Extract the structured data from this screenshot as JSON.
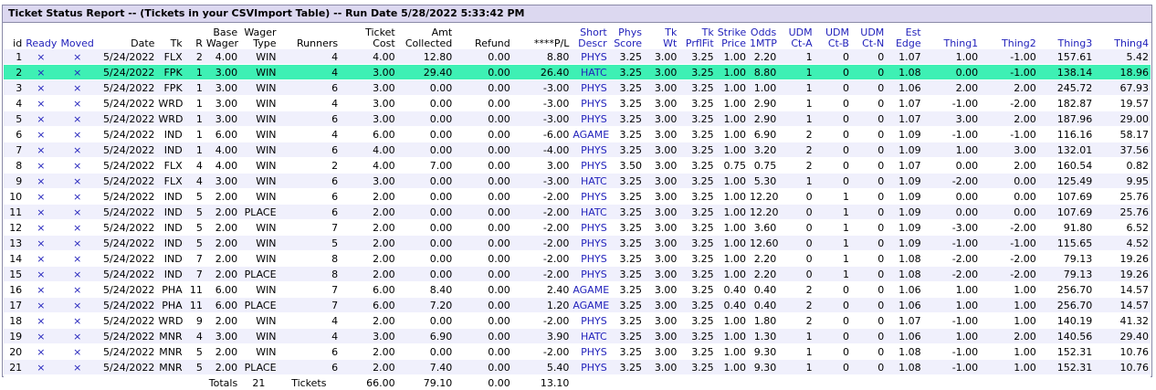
{
  "report": {
    "title": "Ticket Status Report -- (Tickets in your CSVImport Table)  -- Run Date 5/28/2022 5:33:42 PM"
  },
  "columns": [
    {
      "key": "id",
      "l1": "",
      "l2": "id",
      "blue": false,
      "w": 22,
      "align": "right"
    },
    {
      "key": "ready",
      "l1": "",
      "l2": "Ready",
      "blue": true,
      "w": 37,
      "align": "center"
    },
    {
      "key": "moved",
      "l1": "",
      "l2": "Moved",
      "blue": true,
      "w": 42,
      "align": "center"
    },
    {
      "key": "date",
      "l1": "",
      "l2": "Date",
      "blue": false,
      "w": 65,
      "align": "right"
    },
    {
      "key": "tk",
      "l1": "",
      "l2": "Tk",
      "blue": false,
      "w": 30,
      "align": "right"
    },
    {
      "key": "r",
      "l1": "",
      "l2": "R",
      "blue": false,
      "w": 22,
      "align": "right"
    },
    {
      "key": "base_wager",
      "l1": "Base",
      "l2": "Wager",
      "blue": false,
      "w": 38,
      "align": "right"
    },
    {
      "key": "wager_type",
      "l1": "Wager",
      "l2": "Type",
      "blue": false,
      "w": 42,
      "align": "right"
    },
    {
      "key": "runners",
      "l1": "",
      "l2": "Runners",
      "blue": false,
      "w": 67,
      "align": "right"
    },
    {
      "key": "ticket_cost",
      "l1": "Ticket",
      "l2": "Cost",
      "blue": false,
      "w": 62,
      "align": "right"
    },
    {
      "key": "amt_collected",
      "l1": "Amt",
      "l2": "Collected",
      "blue": false,
      "w": 62,
      "align": "right"
    },
    {
      "key": "refund",
      "l1": "",
      "l2": "Refund",
      "blue": false,
      "w": 63,
      "align": "right"
    },
    {
      "key": "pl",
      "l1": "",
      "l2": "****P/L",
      "blue": false,
      "w": 64,
      "align": "right"
    },
    {
      "key": "short_descr",
      "l1": "Short",
      "l2": "Descr",
      "blue": true,
      "w": 41,
      "align": "right"
    },
    {
      "key": "phys_score",
      "l1": "Phys",
      "l2": "Score",
      "blue": true,
      "w": 38,
      "align": "right"
    },
    {
      "key": "tk_wt",
      "l1": "Tk",
      "l2": "Wt",
      "blue": true,
      "w": 38,
      "align": "right"
    },
    {
      "key": "tk_prflfit",
      "l1": "Tk",
      "l2": "PrflFit",
      "blue": true,
      "w": 40,
      "align": "right"
    },
    {
      "key": "strike_price",
      "l1": "Strike",
      "l2": "Price",
      "blue": true,
      "w": 35,
      "align": "right"
    },
    {
      "key": "odds_1mtp",
      "l1": "Odds",
      "l2": "1MTP",
      "blue": true,
      "w": 33,
      "align": "right"
    },
    {
      "key": "udm_ct_a",
      "l1": "UDM",
      "l2": "Ct-A",
      "blue": true,
      "w": 39,
      "align": "right"
    },
    {
      "key": "udm_ct_b",
      "l1": "UDM",
      "l2": "Ct-B",
      "blue": true,
      "w": 40,
      "align": "right"
    },
    {
      "key": "udm_ct_n",
      "l1": "UDM",
      "l2": "Ct-N",
      "blue": true,
      "w": 38,
      "align": "right"
    },
    {
      "key": "est_edge",
      "l1": "Est",
      "l2": "Edge",
      "blue": true,
      "w": 40,
      "align": "right"
    },
    {
      "key": "thing1",
      "l1": "",
      "l2": "Thing1",
      "blue": true,
      "w": 62,
      "align": "right"
    },
    {
      "key": "thing2",
      "l1": "",
      "l2": "Thing2",
      "blue": true,
      "w": 63,
      "align": "right"
    },
    {
      "key": "thing3",
      "l1": "",
      "l2": "Thing3",
      "blue": true,
      "w": 61,
      "align": "right"
    },
    {
      "key": "thing4",
      "l1": "",
      "l2": "Thing4",
      "blue": true,
      "w": 61,
      "align": "right"
    }
  ],
  "selected_row": 1,
  "rows": [
    [
      "1",
      "×",
      "×",
      "5/24/2022",
      "FLX",
      "2",
      "4.00",
      "WIN",
      "4",
      "4.00",
      "12.80",
      "0.00",
      "8.80",
      "PHYS",
      "3.25",
      "3.00",
      "3.25",
      "1.00",
      "2.20",
      "1",
      "0",
      "0",
      "1.07",
      "1.00",
      "-1.00",
      "157.61",
      "5.42"
    ],
    [
      "2",
      "×",
      "×",
      "5/24/2022",
      "FPK",
      "1",
      "3.00",
      "WIN",
      "4",
      "3.00",
      "29.40",
      "0.00",
      "26.40",
      "HATC",
      "3.25",
      "3.00",
      "3.25",
      "1.00",
      "8.80",
      "1",
      "0",
      "0",
      "1.08",
      "0.00",
      "-1.00",
      "138.14",
      "18.96"
    ],
    [
      "3",
      "×",
      "×",
      "5/24/2022",
      "FPK",
      "1",
      "3.00",
      "WIN",
      "6",
      "3.00",
      "0.00",
      "0.00",
      "-3.00",
      "PHYS",
      "3.25",
      "3.00",
      "3.25",
      "1.00",
      "1.00",
      "1",
      "0",
      "0",
      "1.06",
      "2.00",
      "2.00",
      "245.72",
      "67.93"
    ],
    [
      "4",
      "×",
      "×",
      "5/24/2022",
      "WRD",
      "1",
      "3.00",
      "WIN",
      "4",
      "3.00",
      "0.00",
      "0.00",
      "-3.00",
      "PHYS",
      "3.25",
      "3.00",
      "3.25",
      "1.00",
      "2.90",
      "1",
      "0",
      "0",
      "1.07",
      "-1.00",
      "-2.00",
      "182.87",
      "19.57"
    ],
    [
      "5",
      "×",
      "×",
      "5/24/2022",
      "WRD",
      "1",
      "3.00",
      "WIN",
      "6",
      "3.00",
      "0.00",
      "0.00",
      "-3.00",
      "PHYS",
      "3.25",
      "3.00",
      "3.25",
      "1.00",
      "2.90",
      "1",
      "0",
      "0",
      "1.07",
      "3.00",
      "2.00",
      "187.96",
      "29.00"
    ],
    [
      "6",
      "×",
      "×",
      "5/24/2022",
      "IND",
      "1",
      "6.00",
      "WIN",
      "4",
      "6.00",
      "0.00",
      "0.00",
      "-6.00",
      "AGAME",
      "3.25",
      "3.00",
      "3.25",
      "1.00",
      "6.90",
      "2",
      "0",
      "0",
      "1.09",
      "-1.00",
      "-1.00",
      "116.16",
      "58.17"
    ],
    [
      "7",
      "×",
      "×",
      "5/24/2022",
      "IND",
      "1",
      "4.00",
      "WIN",
      "6",
      "4.00",
      "0.00",
      "0.00",
      "-4.00",
      "PHYS",
      "3.25",
      "3.00",
      "3.25",
      "1.00",
      "3.20",
      "2",
      "0",
      "0",
      "1.09",
      "1.00",
      "3.00",
      "132.01",
      "37.56"
    ],
    [
      "8",
      "×",
      "×",
      "5/24/2022",
      "FLX",
      "4",
      "4.00",
      "WIN",
      "2",
      "4.00",
      "7.00",
      "0.00",
      "3.00",
      "PHYS",
      "3.50",
      "3.00",
      "3.25",
      "0.75",
      "0.75",
      "2",
      "0",
      "0",
      "1.07",
      "0.00",
      "2.00",
      "160.54",
      "0.82"
    ],
    [
      "9",
      "×",
      "×",
      "5/24/2022",
      "FLX",
      "4",
      "3.00",
      "WIN",
      "6",
      "3.00",
      "0.00",
      "0.00",
      "-3.00",
      "HATC",
      "3.25",
      "3.00",
      "3.25",
      "1.00",
      "5.30",
      "1",
      "0",
      "0",
      "1.09",
      "-2.00",
      "0.00",
      "125.49",
      "9.95"
    ],
    [
      "10",
      "×",
      "×",
      "5/24/2022",
      "IND",
      "5",
      "2.00",
      "WIN",
      "6",
      "2.00",
      "0.00",
      "0.00",
      "-2.00",
      "PHYS",
      "3.25",
      "3.00",
      "3.25",
      "1.00",
      "12.20",
      "0",
      "1",
      "0",
      "1.09",
      "0.00",
      "0.00",
      "107.69",
      "25.76"
    ],
    [
      "11",
      "×",
      "×",
      "5/24/2022",
      "IND",
      "5",
      "2.00",
      "PLACE",
      "6",
      "2.00",
      "0.00",
      "0.00",
      "-2.00",
      "HATC",
      "3.25",
      "3.00",
      "3.25",
      "1.00",
      "12.20",
      "0",
      "1",
      "0",
      "1.09",
      "0.00",
      "0.00",
      "107.69",
      "25.76"
    ],
    [
      "12",
      "×",
      "×",
      "5/24/2022",
      "IND",
      "5",
      "2.00",
      "WIN",
      "7",
      "2.00",
      "0.00",
      "0.00",
      "-2.00",
      "PHYS",
      "3.25",
      "3.00",
      "3.25",
      "1.00",
      "3.60",
      "0",
      "1",
      "0",
      "1.09",
      "-3.00",
      "-2.00",
      "91.80",
      "6.52"
    ],
    [
      "13",
      "×",
      "×",
      "5/24/2022",
      "IND",
      "5",
      "2.00",
      "WIN",
      "5",
      "2.00",
      "0.00",
      "0.00",
      "-2.00",
      "PHYS",
      "3.25",
      "3.00",
      "3.25",
      "1.00",
      "12.60",
      "0",
      "1",
      "0",
      "1.09",
      "-1.00",
      "-1.00",
      "115.65",
      "4.52"
    ],
    [
      "14",
      "×",
      "×",
      "5/24/2022",
      "IND",
      "7",
      "2.00",
      "WIN",
      "8",
      "2.00",
      "0.00",
      "0.00",
      "-2.00",
      "PHYS",
      "3.25",
      "3.00",
      "3.25",
      "1.00",
      "2.20",
      "0",
      "1",
      "0",
      "1.08",
      "-2.00",
      "-2.00",
      "79.13",
      "19.26"
    ],
    [
      "15",
      "×",
      "×",
      "5/24/2022",
      "IND",
      "7",
      "2.00",
      "PLACE",
      "8",
      "2.00",
      "0.00",
      "0.00",
      "-2.00",
      "PHYS",
      "3.25",
      "3.00",
      "3.25",
      "1.00",
      "2.20",
      "0",
      "1",
      "0",
      "1.08",
      "-2.00",
      "-2.00",
      "79.13",
      "19.26"
    ],
    [
      "16",
      "×",
      "×",
      "5/24/2022",
      "PHA",
      "11",
      "6.00",
      "WIN",
      "7",
      "6.00",
      "8.40",
      "0.00",
      "2.40",
      "AGAME",
      "3.25",
      "3.00",
      "3.25",
      "0.40",
      "0.40",
      "2",
      "0",
      "0",
      "1.06",
      "1.00",
      "1.00",
      "256.70",
      "14.57"
    ],
    [
      "17",
      "×",
      "×",
      "5/24/2022",
      "PHA",
      "11",
      "6.00",
      "PLACE",
      "7",
      "6.00",
      "7.20",
      "0.00",
      "1.20",
      "AGAME",
      "3.25",
      "3.00",
      "3.25",
      "0.40",
      "0.40",
      "2",
      "0",
      "0",
      "1.06",
      "1.00",
      "1.00",
      "256.70",
      "14.57"
    ],
    [
      "18",
      "×",
      "×",
      "5/24/2022",
      "WRD",
      "9",
      "2.00",
      "WIN",
      "4",
      "2.00",
      "0.00",
      "0.00",
      "-2.00",
      "PHYS",
      "3.25",
      "3.00",
      "3.25",
      "1.00",
      "1.80",
      "2",
      "0",
      "0",
      "1.07",
      "-1.00",
      "1.00",
      "140.19",
      "41.32"
    ],
    [
      "19",
      "×",
      "×",
      "5/24/2022",
      "MNR",
      "4",
      "3.00",
      "WIN",
      "4",
      "3.00",
      "6.90",
      "0.00",
      "3.90",
      "HATC",
      "3.25",
      "3.00",
      "3.25",
      "1.00",
      "1.30",
      "1",
      "0",
      "0",
      "1.06",
      "1.00",
      "2.00",
      "140.56",
      "29.40"
    ],
    [
      "20",
      "×",
      "×",
      "5/24/2022",
      "MNR",
      "5",
      "2.00",
      "WIN",
      "6",
      "2.00",
      "0.00",
      "0.00",
      "-2.00",
      "PHYS",
      "3.25",
      "3.00",
      "3.25",
      "1.00",
      "9.30",
      "1",
      "0",
      "0",
      "1.08",
      "-1.00",
      "1.00",
      "152.31",
      "10.76"
    ],
    [
      "21",
      "×",
      "×",
      "5/24/2022",
      "MNR",
      "5",
      "2.00",
      "PLACE",
      "6",
      "2.00",
      "7.40",
      "0.00",
      "5.40",
      "PHYS",
      "3.25",
      "3.00",
      "3.25",
      "1.00",
      "9.30",
      "1",
      "0",
      "0",
      "1.08",
      "-1.00",
      "1.00",
      "152.31",
      "10.76"
    ]
  ],
  "totals": {
    "label": "Totals",
    "count": "21",
    "tickets_label": "Tickets",
    "ticket_cost": "66.00",
    "amt_collected": "79.10",
    "refund": "0.00",
    "pl": "13.10"
  }
}
